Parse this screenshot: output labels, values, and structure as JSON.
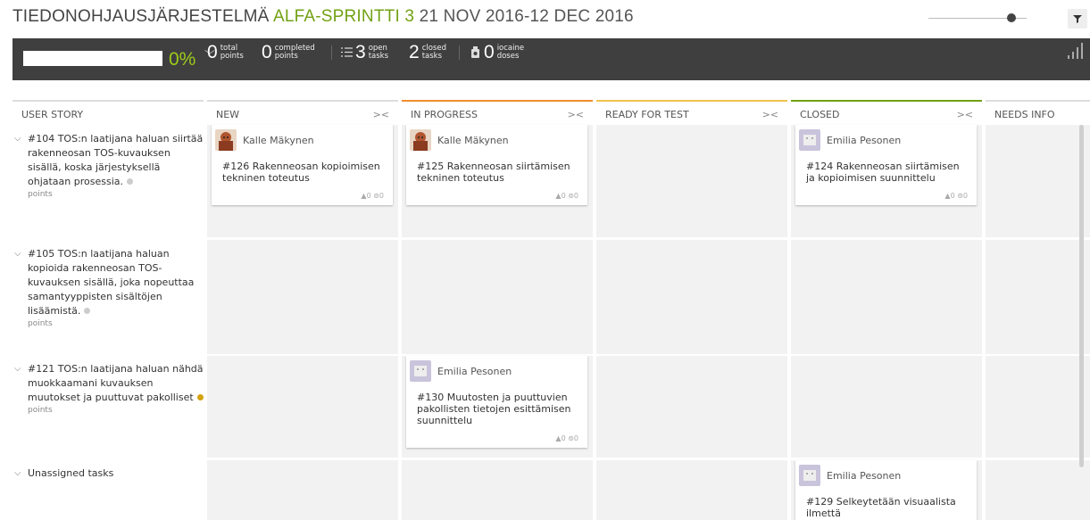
{
  "header": {
    "project": "TIEDONOHJAUSJÄRJESTELMÄ",
    "sprint": "ALFA-SPRINTTI 3",
    "dates": "21 NOV 2016-12 DEC 2016"
  },
  "stats": {
    "progress_pct": "0%",
    "progress_value": 0,
    "total_points": {
      "num": "0",
      "l1": "total",
      "l2": "points"
    },
    "completed_points": {
      "num": "0",
      "l1": "completed",
      "l2": "points"
    },
    "open_tasks": {
      "num": "3",
      "l1": "open",
      "l2": "tasks"
    },
    "closed_tasks": {
      "num": "2",
      "l1": "closed",
      "l2": "tasks"
    },
    "iocaine": {
      "num": "0",
      "l1": "iocaine",
      "l2": "doses"
    }
  },
  "columns": {
    "user_story": "USER STORY",
    "new": "NEW",
    "in_progress": "IN PROGRESS",
    "ready_for_test": "READY FOR TEST",
    "closed": "CLOSED",
    "needs_info": "NEEDS INFO",
    "fold_glyph": "><",
    "colors": {
      "in_progress": "#f08d2e",
      "ready_for_test": "#f0c34e",
      "closed": "#72a114"
    }
  },
  "stories": [
    {
      "text": "#104 TOS:n laatijana haluan siirtää rakenneosan TOS-kuvauksen sisällä, koska järjestyksellä ohjataan prosessia.",
      "points": "points",
      "dot": "#cccccc"
    },
    {
      "text": "#105 TOS:n laatijana haluan kopioida rakenneosan TOS-kuvauksen sisällä, joka nopeuttaa samantyyppisten sisältöjen lisäämistä.",
      "points": "points",
      "dot": "#cccccc"
    },
    {
      "text": "#121 TOS:n laatijana haluan nähdä muokkaamani kuvauksen muutokset ja puuttuvat pakolliset",
      "points": "points",
      "dot": "#d4a20e"
    },
    {
      "text": "Unassigned tasks",
      "points": "",
      "dot": ""
    }
  ],
  "cards": {
    "c126": {
      "owner": "Kalle Mäkynen",
      "subject": "#126 Rakenneosan kopioimisen tekninen toteutus",
      "meta": "▲0 ⊚0"
    },
    "c125": {
      "owner": "Kalle Mäkynen",
      "subject": "#125 Rakenneosan siirtämisen tekninen toteutus",
      "meta": "▲0 ⊚0"
    },
    "c124": {
      "owner": "Emilia Pesonen",
      "subject": "#124 Rakenneosan siirtämisen ja kopioimisen suunnittelu",
      "meta": "▲0 ⊚0"
    },
    "c130": {
      "owner": "Emilia Pesonen",
      "subject": "#130 Muutosten ja puuttuvien pakollisten tietojen esittämisen suunnittelu",
      "meta": "▲0 ⊚0"
    },
    "c129": {
      "owner": "Emilia Pesonen",
      "subject": "#129 Selkeytetään visuaalista ilmettä",
      "meta": ""
    }
  }
}
